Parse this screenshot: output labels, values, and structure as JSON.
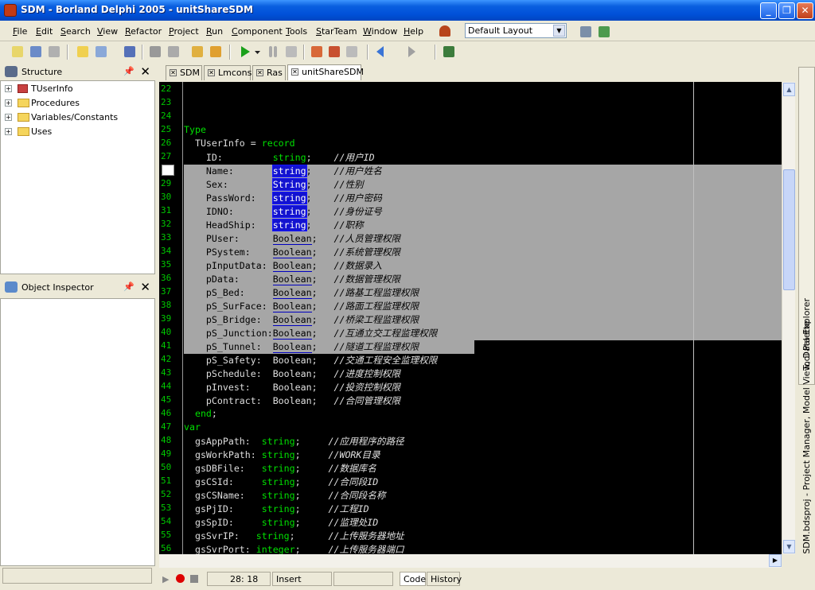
{
  "window": {
    "title": "SDM - Borland Delphi 2005 - unitShareSDM"
  },
  "menu": [
    "File",
    "Edit",
    "Search",
    "View",
    "Refactor",
    "Project",
    "Run",
    "Component",
    "Tools",
    "StarTeam",
    "Window",
    "Help"
  ],
  "layout_combo": {
    "value": "Default Layout"
  },
  "structure": {
    "title": "Structure",
    "items": [
      "TUserInfo",
      "Procedures",
      "Variables/Constants",
      "Uses"
    ]
  },
  "object_inspector": {
    "title": "Object Inspector"
  },
  "tabs": [
    "SDM",
    "Lmcons",
    "Ras",
    "unitShareSDM"
  ],
  "active_tab": "unitShareSDM",
  "editor": {
    "line_numbers": [
      "22",
      "23",
      "24",
      "25",
      "26",
      "27",
      "28",
      "29",
      "30",
      "31",
      "32",
      "33",
      "34",
      "35",
      "36",
      "37",
      "38",
      "39",
      "40",
      "41",
      "42",
      "43",
      "44",
      "45",
      "46",
      "47",
      "48",
      "49",
      "50",
      "51",
      "52",
      "53",
      "54",
      "55",
      "56"
    ],
    "lines": [
      "",
      "",
      "",
      "Type",
      "  TUserInfo = record",
      "    ID:         string;    //用户ID",
      "    Name:       string;    //用户姓名",
      "    Sex:        String;    //性别",
      "    PassWord:   string;    //用户密码",
      "    IDNO:       string;    //身份证号",
      "    HeadShip:   string;    //职称",
      "    PUser:      Boolean;   //人员管理权限",
      "    PSystem:    Boolean;   //系统管理权限",
      "    pInputData: Boolean;   //数据录入",
      "    pData:      Boolean;   //数据管理权限",
      "    pS_Bed:     Boolean;   //路基工程监理权限",
      "    pS_SurFace: Boolean;   //路面工程监理权限",
      "    pS_Bridge:  Boolean;   //桥梁工程监理权限",
      "    pS_Junction:Boolean;   //互通立交工程监理权限",
      "    pS_Tunnel:  Boolean;   //隧道工程监理权限",
      "    pS_Safety:  Boolean;   //交通工程安全监理权限",
      "    pSchedule:  Boolean;   //进度控制权限",
      "    pInvest:    Boolean;   //投资控制权限",
      "    pContract:  Boolean;   //合同管理权限",
      "  end;",
      "var",
      "  gsAppPath:  string;     //应用程序的路径",
      "  gsWorkPath: string;     //WORK目录",
      "  gsDBFile:   string;     //数据库名",
      "  gsCSId:     string;     //合同段ID",
      "  gsCSName:   string;     //合同段名称",
      "  gsPjID:     string;     //工程ID",
      "  gsSpID:     string;     //监理处ID",
      "  gsSvrIP:   string;      //上传服务器地址",
      "  gsSvrPort: integer;     //上传服务器端口"
    ]
  },
  "status": {
    "position": "28: 18",
    "mode": "Insert",
    "code_tab": "Code",
    "history_tab": "History"
  },
  "right_dock": {
    "text1": "Tool Palette",
    "text2": "SDM.bdsproj - Project Manager, Model View, Data Explorer"
  },
  "colors": {
    "keyword": "#00e000",
    "linenum": "#00c800",
    "selection": "#a6a6a6",
    "titlebar": "#0050d8"
  }
}
